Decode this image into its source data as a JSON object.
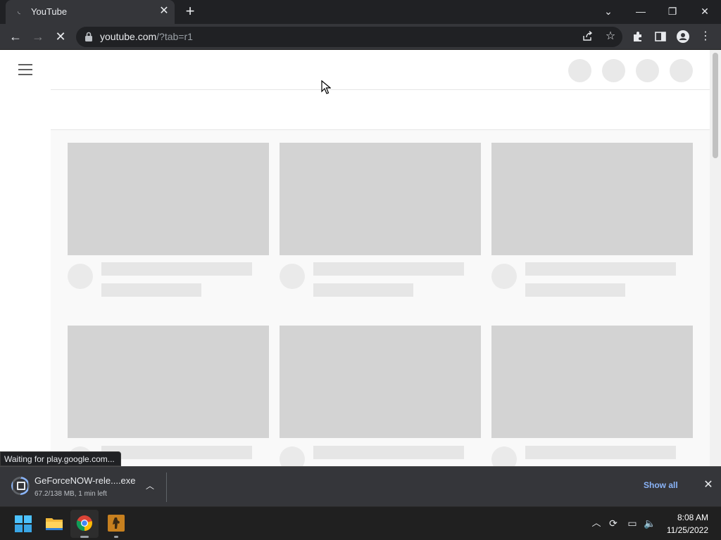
{
  "browser": {
    "tab_title": "YouTube",
    "tab_favicon": "loading-spinner-icon",
    "url_host": "youtube.com",
    "url_path": "/?tab=r1",
    "status_text": "Waiting for play.google.com..."
  },
  "download": {
    "file_name": "GeForceNOW-rele....exe",
    "progress_text": "67.2/138 MB, 1 min left",
    "progress_fraction": 0.487,
    "show_all_label": "Show all"
  },
  "taskbar": {
    "apps": [
      "windows-start-icon",
      "file-explorer-icon",
      "chrome-icon",
      "counter-strike-icon"
    ],
    "time": "8:08 AM",
    "date": "11/25/2022"
  },
  "colors": {
    "skeleton_thumb": "#d3d3d3",
    "skeleton_text": "#e6e6e6",
    "link_accent": "#8ab4f8",
    "chrome_dark": "#202124"
  }
}
